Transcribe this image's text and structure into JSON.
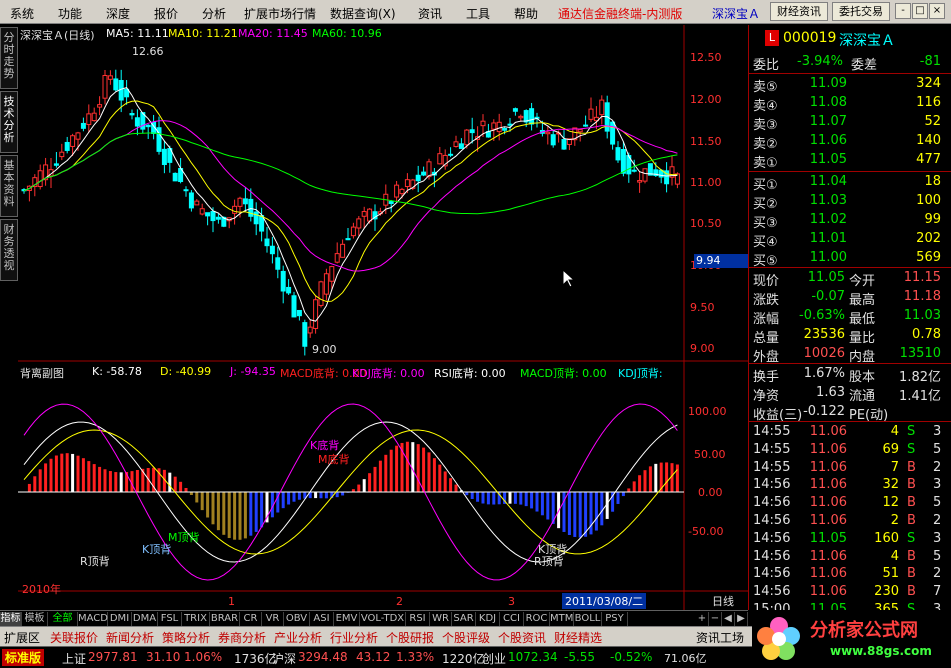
{
  "menu": {
    "items": [
      "系统",
      "功能",
      "深度",
      "报价",
      "分析",
      "扩展市场行情",
      "数据查询(X)",
      "资讯",
      "工具",
      "帮助"
    ],
    "brand": "通达信金融终端-内测版",
    "stock_brand": "深深宝Ａ",
    "btn_finance": "财经资讯",
    "btn_trade": "委托交易"
  },
  "window_buttons": [
    "-",
    "□",
    "×"
  ],
  "left_tabs": [
    "分时走势",
    "技术分析",
    "基本资料",
    "财务透视"
  ],
  "chart": {
    "header_name": "深深宝Ａ",
    "header_period": "(日线)",
    "ma": [
      {
        "label": "MA5: 11.11",
        "color": "#ffffff"
      },
      {
        "label": "MA10: 11.21",
        "color": "#ffff00"
      },
      {
        "label": "MA20: 11.45",
        "color": "#ff00ff"
      },
      {
        "label": "MA60: 10.96",
        "color": "#00ff00"
      }
    ],
    "price_ticks": [
      "12.50",
      "12.00",
      "11.50",
      "11.00",
      "10.50",
      "10.00",
      "9.50",
      "9.00"
    ],
    "high_label": "12.66",
    "low_label": "9.00",
    "current_price_tag": "9.94",
    "sub_title": "背离副图",
    "sub_values": [
      {
        "label": "K: -58.78",
        "color": "#ffffff"
      },
      {
        "label": "D: -40.99",
        "color": "#ffff00"
      },
      {
        "label": "J: -94.35",
        "color": "#ff00ff"
      },
      {
        "label": "MACD底背: 0.00",
        "color": "#ff0000"
      },
      {
        "label": "KDJ底背: 0.00",
        "color": "#ff00ff"
      },
      {
        "label": "RSI底背: 0.00",
        "color": "#ffffff"
      },
      {
        "label": "MACD顶背: 0.00",
        "color": "#00ff00"
      },
      {
        "label": "KDJ顶背:",
        "color": "#00ffff"
      }
    ],
    "sub_ticks": [
      "100.00",
      "50.00",
      "0.00",
      "-50.00"
    ],
    "annotations": [
      "R顶背",
      "K顶背",
      "M顶背",
      "K底背",
      "M底背",
      "K顶背",
      "R顶背"
    ],
    "time_labels": [
      "2010年",
      "1",
      "2",
      "3"
    ],
    "date_box": "2011/03/08/二",
    "period_label": "日线"
  },
  "bottom_tabs": [
    "指标",
    "模板",
    "全部",
    "MACD",
    "DMI",
    "DMA",
    "FSL",
    "TRIX",
    "BRAR",
    "CR",
    "VR",
    "OBV",
    "ASI",
    "EMV",
    "VOL-TDX",
    "RSI",
    "WR",
    "SAR",
    "KDJ",
    "CCI",
    "ROC",
    "MTM",
    "BOLL",
    "PSY"
  ],
  "scroll_buttons": [
    "+",
    "−",
    "◀",
    "▶"
  ],
  "quote": {
    "code": "000019",
    "name": "深深宝Ａ",
    "badge": "L",
    "webi_label": "委比",
    "webi": "-3.94%",
    "wecha_label": "委差",
    "wecha": "-81",
    "sell": [
      {
        "label": "卖⑤",
        "price": "11.09",
        "vol": "324"
      },
      {
        "label": "卖④",
        "price": "11.08",
        "vol": "116"
      },
      {
        "label": "卖③",
        "price": "11.07",
        "vol": "52"
      },
      {
        "label": "卖②",
        "price": "11.06",
        "vol": "140"
      },
      {
        "label": "卖①",
        "price": "11.05",
        "vol": "477"
      }
    ],
    "buy": [
      {
        "label": "买①",
        "price": "11.04",
        "vol": "18"
      },
      {
        "label": "买②",
        "price": "11.03",
        "vol": "100"
      },
      {
        "label": "买③",
        "price": "11.02",
        "vol": "99"
      },
      {
        "label": "买④",
        "price": "11.01",
        "vol": "202"
      },
      {
        "label": "买⑤",
        "price": "11.00",
        "vol": "569"
      }
    ],
    "stats": [
      {
        "l1": "现价",
        "v1": "11.05",
        "c1": "grn",
        "l2": "今开",
        "v2": "11.15",
        "c2": "red"
      },
      {
        "l1": "涨跌",
        "v1": "-0.07",
        "c1": "grn",
        "l2": "最高",
        "v2": "11.18",
        "c2": "red"
      },
      {
        "l1": "涨幅",
        "v1": "-0.63%",
        "c1": "grn",
        "l2": "最低",
        "v2": "11.03",
        "c2": "grn"
      },
      {
        "l1": "总量",
        "v1": "23536",
        "c1": "yel",
        "l2": "量比",
        "v2": "0.78",
        "c2": "yel"
      },
      {
        "l1": "外盘",
        "v1": "10026",
        "c1": "red",
        "l2": "内盘",
        "v2": "13510",
        "c2": "grn"
      }
    ],
    "stats2": [
      {
        "l1": "换手",
        "v1": "1.67%",
        "l2": "股本",
        "v2": "1.82亿"
      },
      {
        "l1": "净资",
        "v1": "1.63",
        "l2": "流通",
        "v2": "1.41亿"
      },
      {
        "l1": "收益(三)",
        "v1": "-0.122",
        "l2": "PE(动)",
        "v2": ""
      }
    ],
    "ticks": [
      {
        "time": "14:55",
        "price": "11.06",
        "vol": "4",
        "side": "S",
        "n": "3"
      },
      {
        "time": "14:55",
        "price": "11.06",
        "vol": "69",
        "side": "S",
        "n": "5"
      },
      {
        "time": "14:55",
        "price": "11.06",
        "vol": "7",
        "side": "B",
        "n": "2"
      },
      {
        "time": "14:56",
        "price": "11.06",
        "vol": "32",
        "side": "B",
        "n": "3"
      },
      {
        "time": "14:56",
        "price": "11.06",
        "vol": "12",
        "side": "B",
        "n": "5"
      },
      {
        "time": "14:56",
        "price": "11.06",
        "vol": "2",
        "side": "B",
        "n": "2"
      },
      {
        "time": "14:56",
        "price": "11.05",
        "vol": "160",
        "side": "S",
        "n": "3"
      },
      {
        "time": "14:56",
        "price": "11.06",
        "vol": "4",
        "side": "B",
        "n": "5"
      },
      {
        "time": "14:56",
        "price": "11.06",
        "vol": "51",
        "side": "B",
        "n": "2"
      },
      {
        "time": "14:56",
        "price": "11.06",
        "vol": "230",
        "side": "B",
        "n": "7"
      },
      {
        "time": "15:00",
        "price": "11.05",
        "vol": "365",
        "side": "S",
        "n": "3"
      }
    ]
  },
  "func_tabs": [
    "扩展区",
    "关联报价",
    "新闻分析",
    "策略分析",
    "券商分析",
    "产业分析",
    "行业分析",
    "个股研报",
    "个股评级",
    "个股资讯",
    "财经精选"
  ],
  "func_right": "资讯工场",
  "status": {
    "badge": "标准版",
    "sh_label": "上证",
    "sh_val": "2977.81",
    "sh_chg": "31.10",
    "sh_pct": "1.06%",
    "sh_amt": "1736亿",
    "hs_label": "沪深",
    "hs_val": "3294.48",
    "hs_chg": "43.12",
    "hs_pct": "1.33%",
    "hs_amt": "1220亿",
    "cy_label": "创业",
    "cy_val": "1072.34",
    "cy_chg": "-5.55",
    "cy_pct": "-0.52%",
    "cy_amt": "71.06亿"
  },
  "logo": {
    "text": "分析家公式网",
    "url": "www.88gs.com"
  }
}
